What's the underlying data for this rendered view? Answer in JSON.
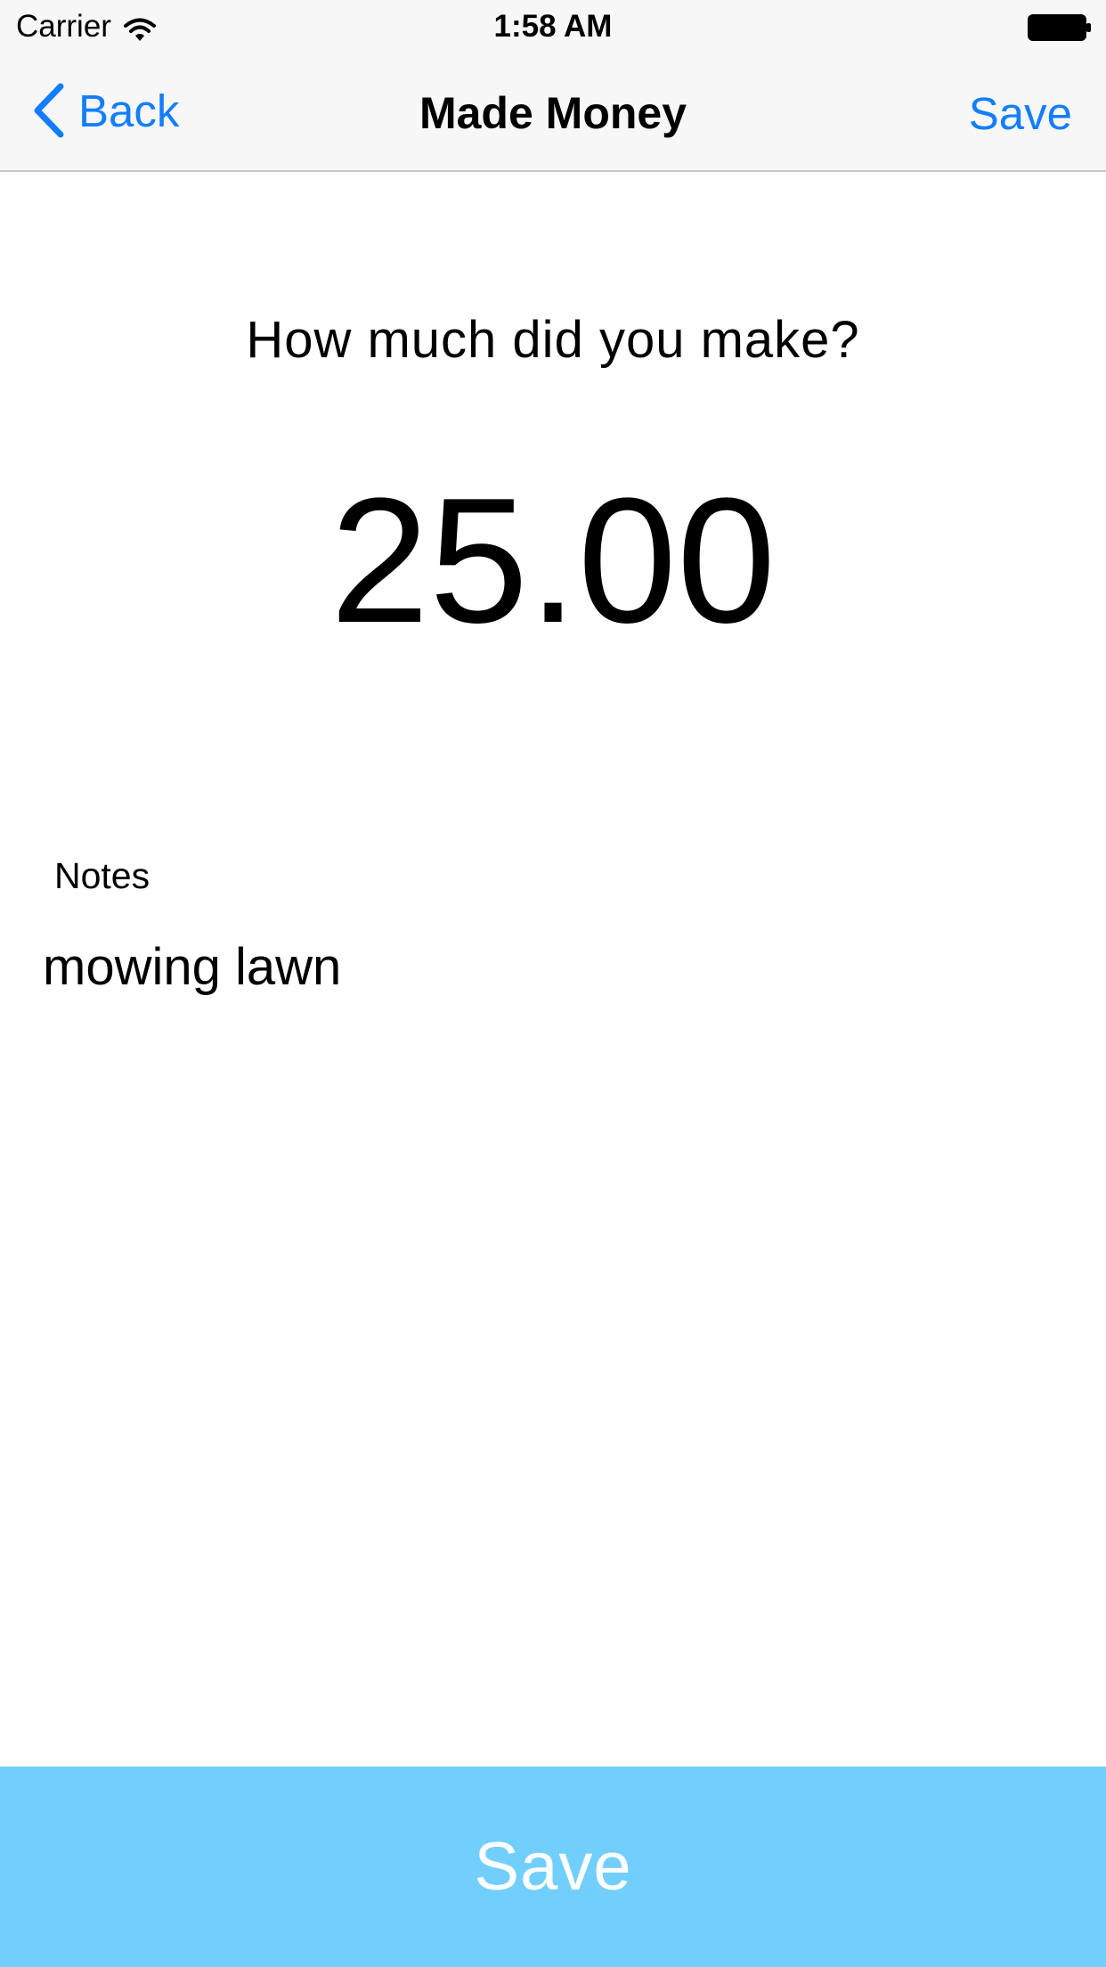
{
  "status_bar": {
    "carrier": "Carrier",
    "time": "1:58 AM",
    "wifi_icon": "wifi-icon",
    "battery_icon": "battery-full-icon"
  },
  "nav": {
    "back_label": "Back",
    "back_icon": "chevron-left-icon",
    "title": "Made Money",
    "save_label": "Save"
  },
  "form": {
    "prompt": "How much did you make?",
    "amount": "25.00",
    "notes_label": "Notes",
    "notes_value": "mowing lawn"
  },
  "footer": {
    "save_label": "Save"
  },
  "colors": {
    "accent": "#137efb",
    "save_bar": "#72cffd",
    "nav_background": "#f7f7f7"
  }
}
